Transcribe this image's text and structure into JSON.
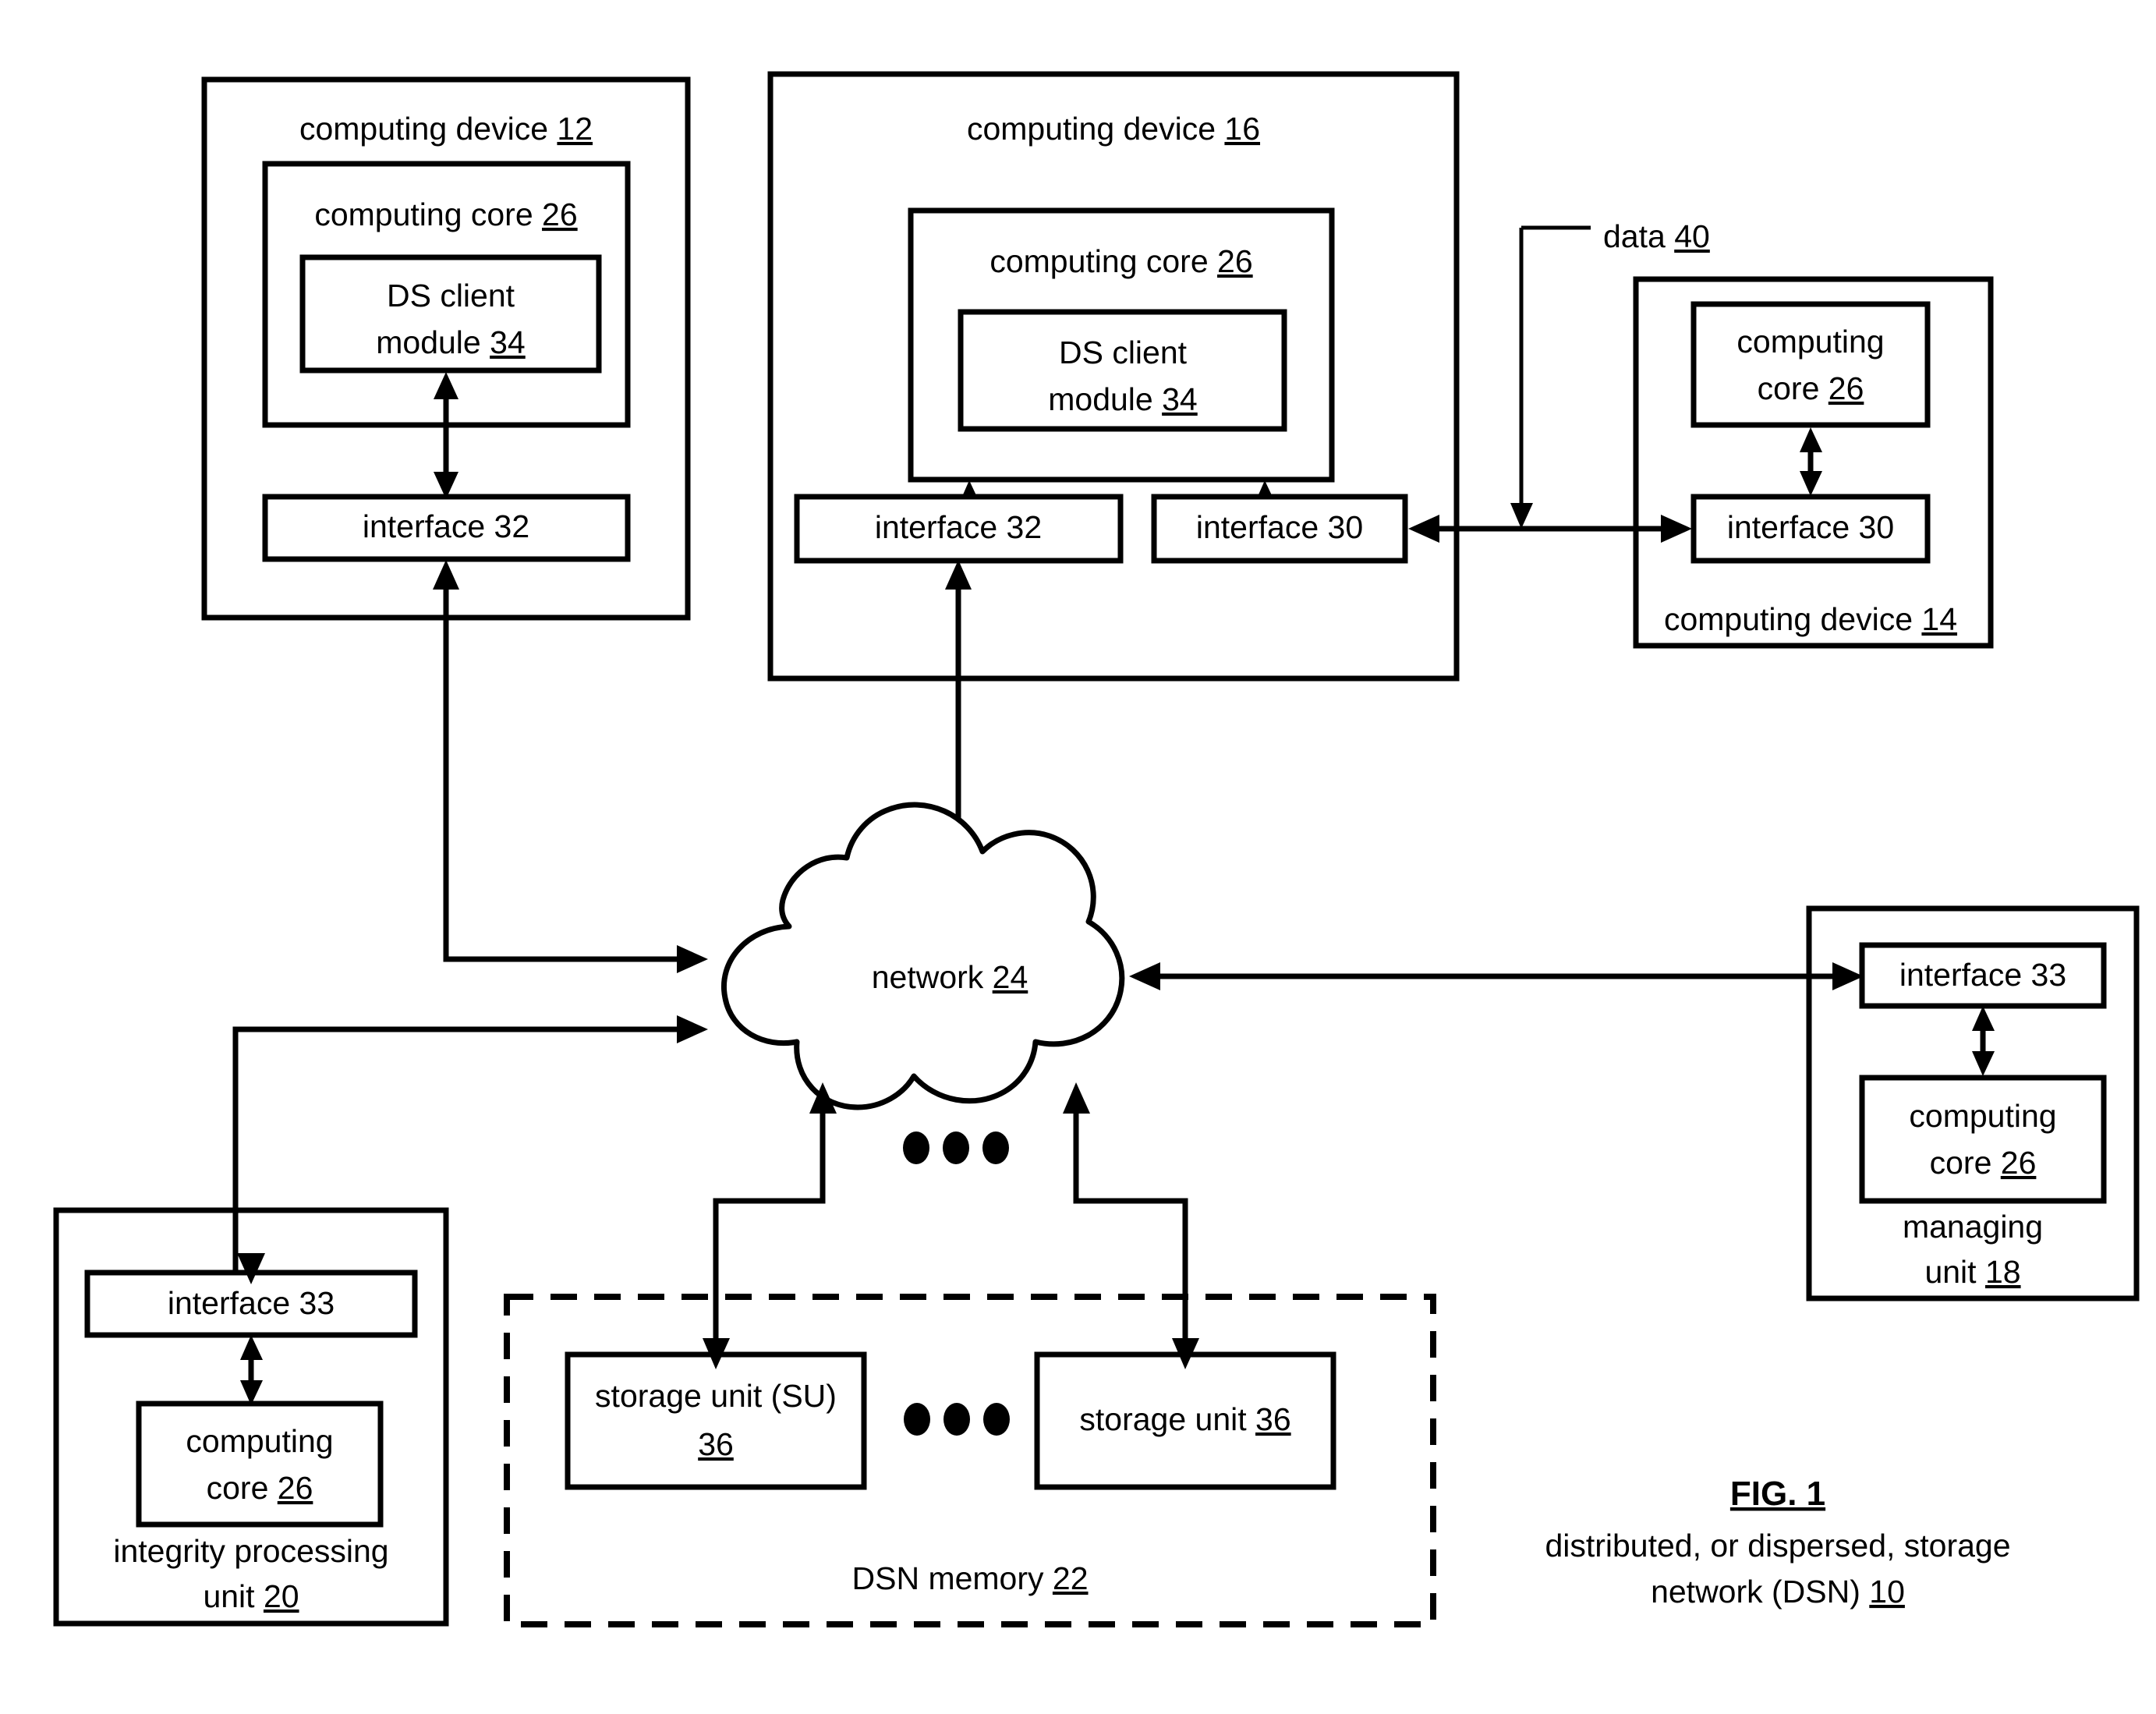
{
  "figure": {
    "title": "FIG. 1",
    "caption_line1": "distributed, or dispersed, storage",
    "caption_line2": "network (DSN) ",
    "caption_ref": "10"
  },
  "computing_device_12": {
    "title_text": "computing device ",
    "title_ref": "12",
    "core": {
      "text": "computing core ",
      "ref": "26"
    },
    "ds_client": {
      "line1": "DS client",
      "line2_text": "module ",
      "line2_ref": "34"
    },
    "interface": {
      "text": "interface 32"
    }
  },
  "computing_device_16": {
    "title_text": "computing device ",
    "title_ref": "16",
    "core": {
      "text": "computing core ",
      "ref": "26"
    },
    "ds_client": {
      "line1": "DS client",
      "line2_text": "module ",
      "line2_ref": "34"
    },
    "interface_32": {
      "text": "interface 32"
    },
    "interface_30": {
      "text": "interface 30"
    }
  },
  "computing_device_14": {
    "title_text": "computing device ",
    "title_ref": "14",
    "core": {
      "line1": "computing",
      "line2_text": "core ",
      "line2_ref": "26"
    },
    "interface_30": {
      "text": "interface 30"
    }
  },
  "data_flow": {
    "label_text": "data ",
    "label_ref": "40"
  },
  "network": {
    "text": "network ",
    "ref": "24"
  },
  "managing_unit_18": {
    "interface_33": {
      "text": "interface 33"
    },
    "core": {
      "line1": "computing",
      "line2_text": "core ",
      "line2_ref": "26"
    },
    "title_line1": "managing",
    "title_line2_text": "unit ",
    "title_line2_ref": "18"
  },
  "integrity_processing_unit_20": {
    "interface_33": {
      "text": "interface 33"
    },
    "core": {
      "line1": "computing",
      "line2_text": "core ",
      "line2_ref": "26"
    },
    "title_line1": "integrity  processing",
    "title_line2_text": "unit ",
    "title_line2_ref": "20"
  },
  "dsn_memory_22": {
    "title_text": "DSN memory ",
    "title_ref": "22",
    "storage_unit_first": {
      "line1": "storage unit (SU)",
      "line2_ref": "36"
    },
    "storage_unit_last": {
      "text": "storage unit ",
      "ref": "36"
    },
    "ellipsis": "● ● ●"
  },
  "colors": {
    "stroke": "#000000",
    "background": "#ffffff"
  }
}
